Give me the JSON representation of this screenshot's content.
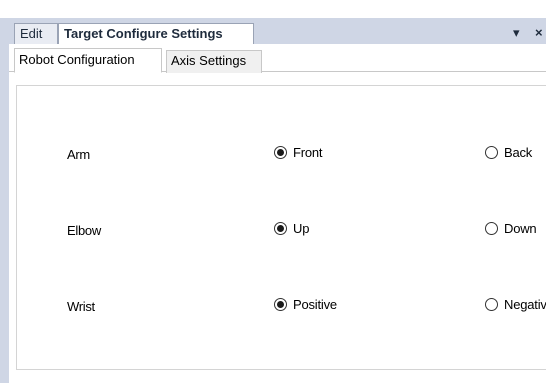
{
  "window": {
    "tabs": [
      {
        "label": "Edit",
        "active": false
      },
      {
        "label": "Target Configure Settings",
        "active": true
      }
    ],
    "pin_glyph": "▾",
    "close_glyph": "×"
  },
  "inner_tabs": [
    {
      "label": "Robot Configuration",
      "active": true
    },
    {
      "label": "Axis Settings",
      "active": false
    }
  ],
  "config": {
    "rows": [
      {
        "label": "Arm",
        "options": [
          {
            "label": "Front",
            "checked": true
          },
          {
            "label": "Back",
            "checked": false
          }
        ]
      },
      {
        "label": "Elbow",
        "options": [
          {
            "label": "Up",
            "checked": true
          },
          {
            "label": "Down",
            "checked": false
          }
        ]
      },
      {
        "label": "Wrist",
        "options": [
          {
            "label": "Positive",
            "checked": true
          },
          {
            "label": "Negative",
            "checked": false
          }
        ]
      }
    ]
  },
  "colors": {
    "chrome": "#cfd6e5",
    "border": "#9aa3b5"
  }
}
